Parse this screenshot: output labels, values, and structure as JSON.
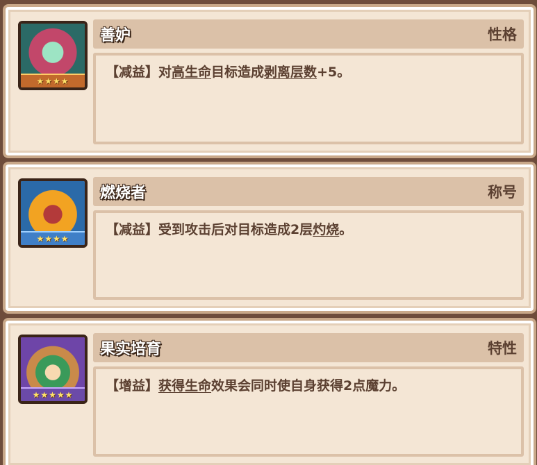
{
  "cards": [
    {
      "name": "善妒",
      "tag": "性格",
      "stars": "★★★★",
      "desc": [
        {
          "text": "【减益】对"
        },
        {
          "text": "高生命",
          "kw": true
        },
        {
          "text": "目标造成"
        },
        {
          "text": "剥离层数",
          "kw": true
        },
        {
          "text": "+5。"
        }
      ]
    },
    {
      "name": "燃烧者",
      "tag": "称号",
      "stars": "★★★★",
      "desc": [
        {
          "text": "【减益】受到攻击后对目标造成2层"
        },
        {
          "text": "灼烧",
          "kw": true
        },
        {
          "text": "。"
        }
      ]
    },
    {
      "name": "果实培育",
      "tag": "特性",
      "stars": "★★★★★",
      "desc": [
        {
          "text": "【增益】"
        },
        {
          "text": "获得生命",
          "kw": true
        },
        {
          "text": "效果会同时使自身获得2点魔力。"
        }
      ]
    }
  ]
}
